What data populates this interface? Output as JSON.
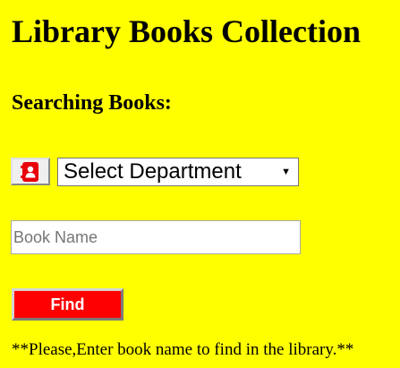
{
  "page": {
    "title": "Library Books Collection",
    "subtitle": "Searching Books:",
    "background_color": "#ffff00"
  },
  "department": {
    "icon": "address-book-icon",
    "icon_color": "#e8000b",
    "select_value": "Select Department"
  },
  "book_search": {
    "placeholder": "Book Name",
    "value": ""
  },
  "find_button": {
    "label": "Find",
    "color": "#ff0000"
  },
  "note": "**Please,Enter book name to find in the library.**"
}
